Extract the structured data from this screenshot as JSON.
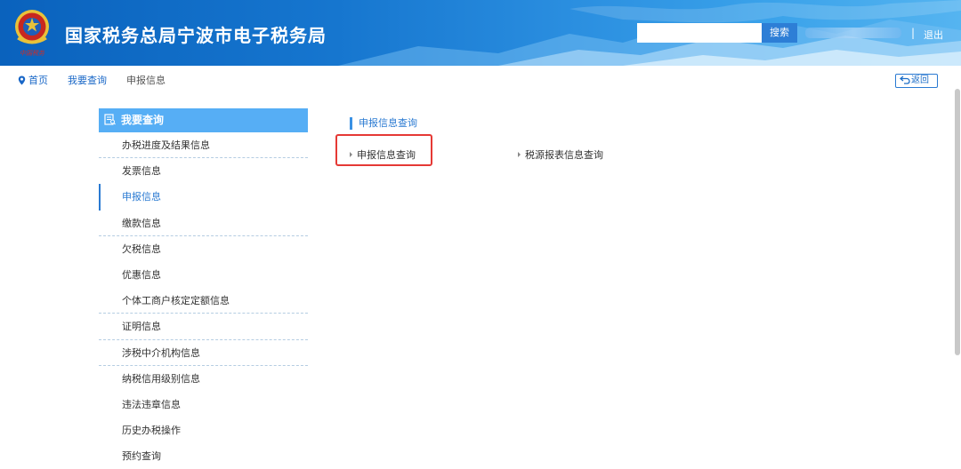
{
  "header": {
    "title": "国家税务总局宁波市电子税务局",
    "emblem_text": "中国税务",
    "search": {
      "value": "",
      "placeholder": "",
      "button_label": "搜索"
    },
    "divider": "|",
    "logout_label": "退出"
  },
  "breadcrumb": {
    "home": "首页",
    "level1": "我要查询",
    "current": "申报信息",
    "back_label": "返回"
  },
  "sidebar": {
    "title": "我要查询",
    "items": [
      {
        "label": "办税进度及结果信息"
      },
      {
        "label": "发票信息"
      },
      {
        "label": "申报信息"
      },
      {
        "label": "缴款信息"
      },
      {
        "label": "欠税信息"
      },
      {
        "label": "优惠信息"
      },
      {
        "label": "个体工商户核定定额信息"
      },
      {
        "label": "证明信息"
      },
      {
        "label": "涉税中介机构信息"
      },
      {
        "label": "纳税信用级别信息"
      },
      {
        "label": "违法违章信息"
      },
      {
        "label": "历史办税操作"
      },
      {
        "label": "预约查询"
      }
    ]
  },
  "main": {
    "section_title": "申报信息查询",
    "links": [
      {
        "label": "申报信息查询"
      },
      {
        "label": "税源报表信息查询"
      }
    ]
  },
  "colors": {
    "accent": "#2a7ad2",
    "sidebar_header": "#56aef5",
    "highlight": "#e53935",
    "header_dark": "#0a62bd"
  }
}
